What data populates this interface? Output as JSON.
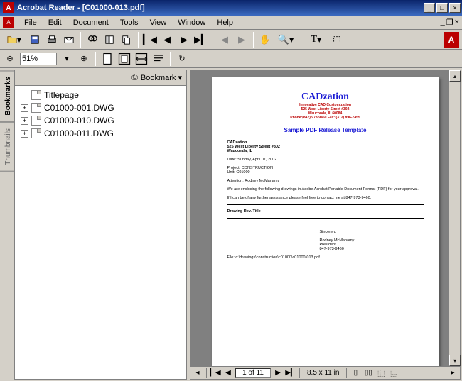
{
  "window": {
    "title": "Acrobat Reader - [C01000-013.pdf]"
  },
  "menu": {
    "file": "File",
    "edit": "Edit",
    "document": "Document",
    "tools": "Tools",
    "view": "View",
    "window": "Window",
    "help": "Help"
  },
  "zoom": {
    "value": "51%"
  },
  "sidetabs": {
    "bookmarks": "Bookmarks",
    "thumbnails": "Thumbnails"
  },
  "panel": {
    "dropdown": "Bookmark",
    "items": [
      {
        "label": "Titlepage",
        "expandable": false
      },
      {
        "label": "C01000-001.DWG",
        "expandable": true
      },
      {
        "label": "C01000-010.DWG",
        "expandable": true
      },
      {
        "label": "C01000-011.DWG",
        "expandable": true
      }
    ]
  },
  "pdf": {
    "brand": "CADzation",
    "tagline1": "Innovative CAD Customization",
    "tagline2": "525 West Liberty Street #302",
    "tagline3": "Wauconda, IL 60084",
    "tagline4": "Phone:(847) 973-9460 Fax: (312) 896-7455",
    "subtitle": "Sample PDF Release Template",
    "addr1": "CADzation",
    "addr2": "525 West Liberty Street #302",
    "addr3": "Wauconda, IL",
    "date": "Date: Sunday, April 07, 2002",
    "project_label": "Project:",
    "project": "CONSTRUCTION",
    "unit_label": "Unit:",
    "unit": "C01000",
    "attention": "Attention: Rodney McManamy",
    "body1": "We are enclosing the following drawings in Adobe Acrobat Portable Document Format (PDF) for your approval.",
    "body2": "If I can be of any further assistance please feel free to contact me at 847-973-9460.",
    "table_head": "Drawing    Rev.    Title",
    "sig_closing": "Sincerely,",
    "sig_name": "Rodney McManamy",
    "sig_title": "President",
    "sig_phone": "847-973-9460",
    "file_label": "File:",
    "file_path": "c:\\drawings\\construction\\c01000\\c01000-013.pdf"
  },
  "status": {
    "page": "1 of 11",
    "dimensions": "8.5 x 11 in"
  }
}
